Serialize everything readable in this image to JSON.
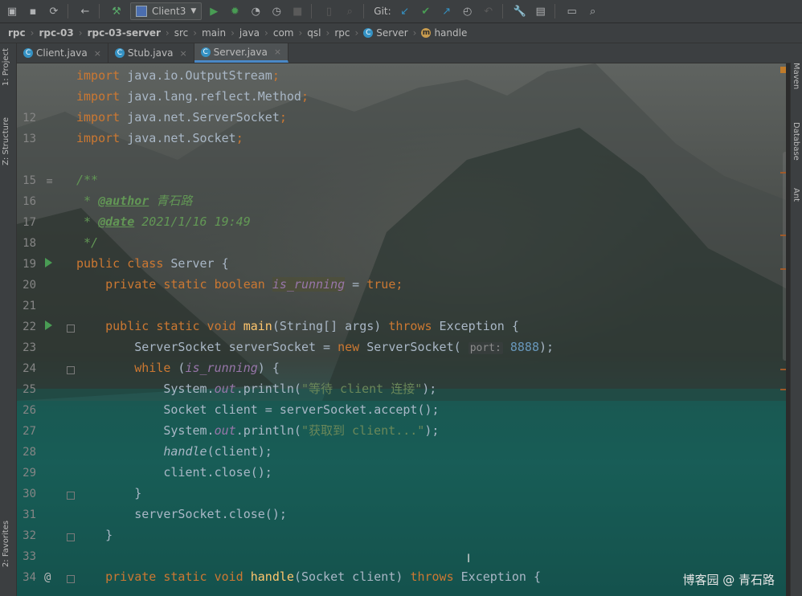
{
  "toolbar": {
    "run_config": "Client3",
    "git_label": "Git:",
    "icons": [
      "folder-icon",
      "save-icon",
      "sync-icon",
      "back-icon",
      "build-hammer-icon",
      "run-config-icon",
      "run-icon",
      "debug-icon",
      "coverage-icon",
      "profile-icon",
      "stop-icon",
      "git-update-icon",
      "git-commit-icon",
      "git-push-icon",
      "history-icon",
      "rollback-icon",
      "settings-wrench-icon",
      "project-structure-icon",
      "window-icon",
      "search-icon"
    ]
  },
  "breadcrumbs": [
    "rpc",
    "rpc-03",
    "rpc-03-server",
    "src",
    "main",
    "java",
    "com",
    "qsl",
    "rpc",
    "Server",
    "handle"
  ],
  "left_tabs": {
    "project": "1: Project",
    "structure": "Z: Structure",
    "favorites": "2: Favorites"
  },
  "right_tabs": {
    "maven": "Maven",
    "database": "Database",
    "ant": "Ant"
  },
  "tabs": [
    {
      "label": "Client.java",
      "active": false
    },
    {
      "label": "Stub.java",
      "active": false
    },
    {
      "label": "Server.java",
      "active": true
    }
  ],
  "line_numbers": [
    "",
    "",
    "12",
    "13",
    "",
    "15",
    "16",
    "17",
    "18",
    "19",
    "20",
    "21",
    "22",
    "23",
    "24",
    "25",
    "26",
    "27",
    "28",
    "29",
    "30",
    "31",
    "32",
    "33",
    "34"
  ],
  "code": {
    "l10_kw": "import",
    "l10_rest": " java.io.OutputStream",
    "l11_kw": "import",
    "l11_rest": " java.lang.reflect.Method",
    "l12_kw": "import",
    "l12_rest": " java.net.ServerSocket",
    "l13_kw": "import",
    "l13_rest": " java.net.Socket",
    "l15": "/**",
    "l16_tag": "@author",
    "l16_text": " 青石路",
    "l17_tag": "@date",
    "l17_text": " 2021/1/16 19:49",
    "l18": " */",
    "l19_kw": "public class",
    "l19_rest": " Server {",
    "l20_kw": "private static boolean",
    "l20_field": "is_running",
    "l20_eq": " = ",
    "l20_val": "true",
    "l22_kw": "public static void",
    "l22_fn": "main",
    "l22_args": "(String[] args) ",
    "l22_throws": "throws",
    "l22_ex": " Exception {",
    "l23_a": "ServerSocket serverSocket = ",
    "l23_new": "new",
    "l23_b": " ServerSocket(",
    "l23_hint": "port:",
    "l23_num": "8888",
    "l23_c": ");",
    "l24_kw": "while",
    "l24_a": " (",
    "l24_field": "is_running",
    "l24_b": ") {",
    "l25_a": "System.",
    "l25_out": "out",
    "l25_b": ".println(",
    "l25_str": "\"等待 client 连接\"",
    "l25_c": ");",
    "l26_a": "Socket client = serverSocket.accept();",
    "l27_a": "System.",
    "l27_out": "out",
    "l27_b": ".println(",
    "l27_str": "\"获取到 client...\"",
    "l27_c": ");",
    "l28_fn": "handle",
    "l28_a": "(client);",
    "l29_a": "client.close();",
    "l30_a": "}",
    "l31_a": "serverSocket.close();",
    "l32_a": "}",
    "l34_kw": "private static void",
    "l34_fn": "handle",
    "l34_a": "(Socket client) ",
    "l34_throws": "throws",
    "l34_ex": " Exception {"
  },
  "watermark": "博客园 @ 青石路",
  "colors": {
    "keyword": "#cc7832",
    "identifier": "#a9b7c6",
    "doc": "#629755",
    "string": "#6a8759",
    "number": "#6897bb",
    "field": "#9876aa",
    "function": "#ffc66d"
  }
}
